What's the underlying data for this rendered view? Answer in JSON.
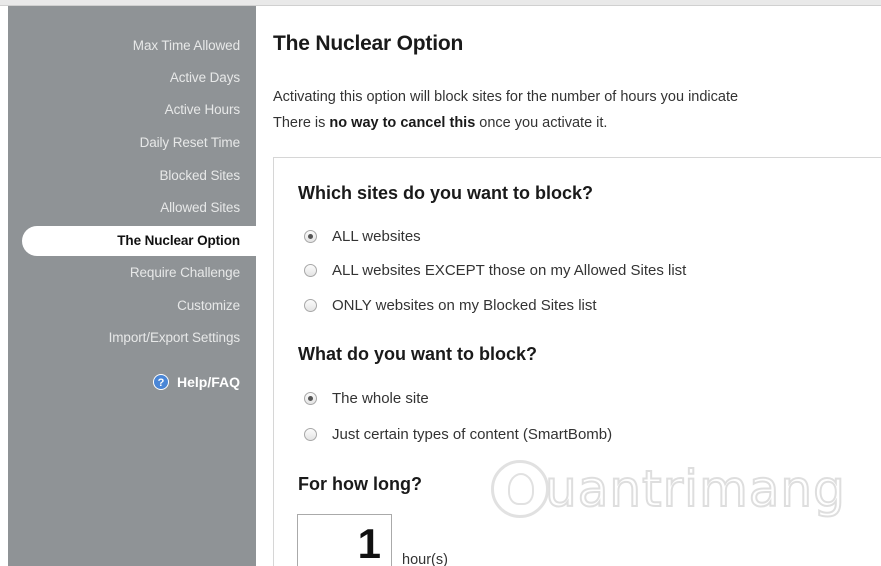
{
  "sidebar": {
    "items": [
      {
        "label": "Max Time Allowed"
      },
      {
        "label": "Active Days"
      },
      {
        "label": "Active Hours"
      },
      {
        "label": "Daily Reset Time"
      },
      {
        "label": "Blocked Sites"
      },
      {
        "label": "Allowed Sites"
      },
      {
        "label": "The Nuclear Option"
      },
      {
        "label": "Require Challenge"
      },
      {
        "label": "Customize"
      },
      {
        "label": "Import/Export Settings"
      }
    ],
    "active_index": 6,
    "help": {
      "label": "Help/FAQ",
      "icon": "help-circle-icon",
      "glyph": "?"
    }
  },
  "main": {
    "title": "The Nuclear Option",
    "intro": {
      "line1": "Activating this option will block sites for the number of hours you indicate",
      "line2_before": "There is ",
      "line2_bold": "no way to cancel this",
      "line2_after": " once you activate it."
    },
    "sites_section": {
      "title": "Which sites do you want to block?",
      "options": [
        {
          "label": "ALL websites",
          "checked": true
        },
        {
          "label": "ALL websites EXCEPT those on my Allowed Sites list",
          "checked": false
        },
        {
          "label": "ONLY websites on my Blocked Sites list",
          "checked": false
        }
      ]
    },
    "what_section": {
      "title": "What do you want to block?",
      "options": [
        {
          "label": "The whole site",
          "checked": true
        },
        {
          "label": "Just certain types of content (SmartBomb)",
          "checked": false
        }
      ]
    },
    "duration_section": {
      "title": "For how long?",
      "value": "1",
      "unit": "hour(s)"
    }
  },
  "watermark": {
    "text": "uantrimang",
    "icon": "lightbulb-logo"
  },
  "colors": {
    "sidebar_bg": "#8f9396",
    "sidebar_text": "#e7e8e8",
    "active_bg": "#ffffff",
    "help_icon": "#4a86d6"
  }
}
